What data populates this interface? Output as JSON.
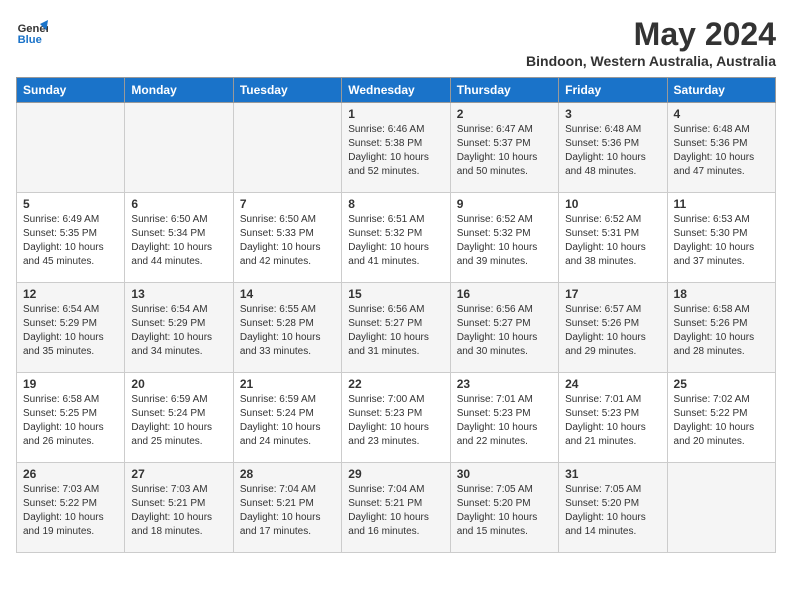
{
  "logo": {
    "line1": "General",
    "line2": "Blue"
  },
  "title": "May 2024",
  "location": "Bindoon, Western Australia, Australia",
  "days_of_week": [
    "Sunday",
    "Monday",
    "Tuesday",
    "Wednesday",
    "Thursday",
    "Friday",
    "Saturday"
  ],
  "weeks": [
    [
      {
        "day": "",
        "info": ""
      },
      {
        "day": "",
        "info": ""
      },
      {
        "day": "",
        "info": ""
      },
      {
        "day": "1",
        "info": "Sunrise: 6:46 AM\nSunset: 5:38 PM\nDaylight: 10 hours\nand 52 minutes."
      },
      {
        "day": "2",
        "info": "Sunrise: 6:47 AM\nSunset: 5:37 PM\nDaylight: 10 hours\nand 50 minutes."
      },
      {
        "day": "3",
        "info": "Sunrise: 6:48 AM\nSunset: 5:36 PM\nDaylight: 10 hours\nand 48 minutes."
      },
      {
        "day": "4",
        "info": "Sunrise: 6:48 AM\nSunset: 5:36 PM\nDaylight: 10 hours\nand 47 minutes."
      }
    ],
    [
      {
        "day": "5",
        "info": "Sunrise: 6:49 AM\nSunset: 5:35 PM\nDaylight: 10 hours\nand 45 minutes."
      },
      {
        "day": "6",
        "info": "Sunrise: 6:50 AM\nSunset: 5:34 PM\nDaylight: 10 hours\nand 44 minutes."
      },
      {
        "day": "7",
        "info": "Sunrise: 6:50 AM\nSunset: 5:33 PM\nDaylight: 10 hours\nand 42 minutes."
      },
      {
        "day": "8",
        "info": "Sunrise: 6:51 AM\nSunset: 5:32 PM\nDaylight: 10 hours\nand 41 minutes."
      },
      {
        "day": "9",
        "info": "Sunrise: 6:52 AM\nSunset: 5:32 PM\nDaylight: 10 hours\nand 39 minutes."
      },
      {
        "day": "10",
        "info": "Sunrise: 6:52 AM\nSunset: 5:31 PM\nDaylight: 10 hours\nand 38 minutes."
      },
      {
        "day": "11",
        "info": "Sunrise: 6:53 AM\nSunset: 5:30 PM\nDaylight: 10 hours\nand 37 minutes."
      }
    ],
    [
      {
        "day": "12",
        "info": "Sunrise: 6:54 AM\nSunset: 5:29 PM\nDaylight: 10 hours\nand 35 minutes."
      },
      {
        "day": "13",
        "info": "Sunrise: 6:54 AM\nSunset: 5:29 PM\nDaylight: 10 hours\nand 34 minutes."
      },
      {
        "day": "14",
        "info": "Sunrise: 6:55 AM\nSunset: 5:28 PM\nDaylight: 10 hours\nand 33 minutes."
      },
      {
        "day": "15",
        "info": "Sunrise: 6:56 AM\nSunset: 5:27 PM\nDaylight: 10 hours\nand 31 minutes."
      },
      {
        "day": "16",
        "info": "Sunrise: 6:56 AM\nSunset: 5:27 PM\nDaylight: 10 hours\nand 30 minutes."
      },
      {
        "day": "17",
        "info": "Sunrise: 6:57 AM\nSunset: 5:26 PM\nDaylight: 10 hours\nand 29 minutes."
      },
      {
        "day": "18",
        "info": "Sunrise: 6:58 AM\nSunset: 5:26 PM\nDaylight: 10 hours\nand 28 minutes."
      }
    ],
    [
      {
        "day": "19",
        "info": "Sunrise: 6:58 AM\nSunset: 5:25 PM\nDaylight: 10 hours\nand 26 minutes."
      },
      {
        "day": "20",
        "info": "Sunrise: 6:59 AM\nSunset: 5:24 PM\nDaylight: 10 hours\nand 25 minutes."
      },
      {
        "day": "21",
        "info": "Sunrise: 6:59 AM\nSunset: 5:24 PM\nDaylight: 10 hours\nand 24 minutes."
      },
      {
        "day": "22",
        "info": "Sunrise: 7:00 AM\nSunset: 5:23 PM\nDaylight: 10 hours\nand 23 minutes."
      },
      {
        "day": "23",
        "info": "Sunrise: 7:01 AM\nSunset: 5:23 PM\nDaylight: 10 hours\nand 22 minutes."
      },
      {
        "day": "24",
        "info": "Sunrise: 7:01 AM\nSunset: 5:23 PM\nDaylight: 10 hours\nand 21 minutes."
      },
      {
        "day": "25",
        "info": "Sunrise: 7:02 AM\nSunset: 5:22 PM\nDaylight: 10 hours\nand 20 minutes."
      }
    ],
    [
      {
        "day": "26",
        "info": "Sunrise: 7:03 AM\nSunset: 5:22 PM\nDaylight: 10 hours\nand 19 minutes."
      },
      {
        "day": "27",
        "info": "Sunrise: 7:03 AM\nSunset: 5:21 PM\nDaylight: 10 hours\nand 18 minutes."
      },
      {
        "day": "28",
        "info": "Sunrise: 7:04 AM\nSunset: 5:21 PM\nDaylight: 10 hours\nand 17 minutes."
      },
      {
        "day": "29",
        "info": "Sunrise: 7:04 AM\nSunset: 5:21 PM\nDaylight: 10 hours\nand 16 minutes."
      },
      {
        "day": "30",
        "info": "Sunrise: 7:05 AM\nSunset: 5:20 PM\nDaylight: 10 hours\nand 15 minutes."
      },
      {
        "day": "31",
        "info": "Sunrise: 7:05 AM\nSunset: 5:20 PM\nDaylight: 10 hours\nand 14 minutes."
      },
      {
        "day": "",
        "info": ""
      }
    ]
  ]
}
